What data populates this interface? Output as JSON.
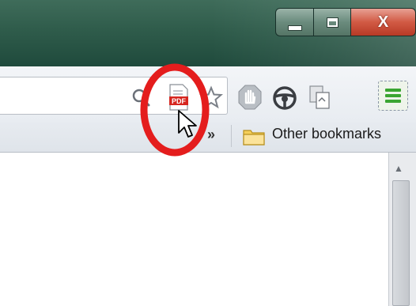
{
  "window": {
    "caption_buttons": {
      "minimize_icon": "minimize-icon",
      "maximize_icon": "maximize-icon",
      "close_label": "X"
    },
    "title_color": "#2f5c4b",
    "close_color": "#d15a44"
  },
  "toolbar": {
    "icons": [
      "search-icon",
      "pdf-icon",
      "star-icon",
      "hand-extension-icon",
      "steering-wheel-icon",
      "pages-icon",
      "wrench-menu-icon"
    ],
    "pdf_label": "PDF"
  },
  "bookmarks_bar": {
    "overflow_label": "»",
    "other_bookmarks_label": "Other bookmarks",
    "folder_icon": "folder-icon"
  },
  "annotation": {
    "shape": "red-ellipse",
    "color": "#e41d1d"
  },
  "scrollbar": {
    "up_arrow": "▲"
  }
}
